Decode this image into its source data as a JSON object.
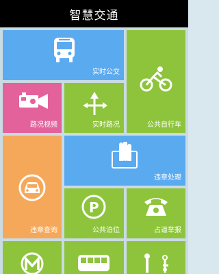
{
  "header": {
    "title": "智慧交通"
  },
  "tiles": {
    "realtime_bus": {
      "label": "实时公交",
      "icon": "bus-icon",
      "color": "#5aaaf0"
    },
    "public_bike": {
      "label": "公共自行车",
      "icon": "bicycle-icon",
      "color": "#8ec43c"
    },
    "traffic_video": {
      "label": "路况视频",
      "icon": "video-camera-icon",
      "color": "#e4629c"
    },
    "realtime_road": {
      "label": "实时路况",
      "icon": "road-arrows-icon",
      "color": "#8ec43c"
    },
    "violation_handle": {
      "label": "违章处理",
      "icon": "hand-payment-icon",
      "color": "#5aaaf0"
    },
    "violation_query": {
      "label": "违章查询",
      "icon": "car-icon",
      "color": "#f5a85a"
    },
    "public_parking": {
      "label": "公共泊位",
      "icon": "parking-icon",
      "color": "#8ec43c"
    },
    "road_report": {
      "label": "占道举报",
      "icon": "telephone-icon",
      "color": "#8ec43c"
    },
    "metro": {
      "label": "",
      "icon": "metro-icon",
      "color": "#8ec43c"
    },
    "coach": {
      "label": "",
      "icon": "coach-bus-icon",
      "color": "#8ec43c"
    },
    "driving": {
      "label": "",
      "icon": "gear-shift-icon",
      "color": "#8ec43c"
    }
  }
}
